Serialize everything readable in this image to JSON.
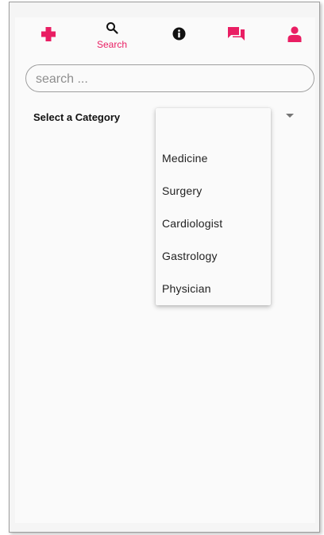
{
  "colors": {
    "accent": "#e91e63",
    "icon_dark": "#111111",
    "border": "#9e9e9e",
    "text": "#222222"
  },
  "nav": {
    "items": [
      {
        "icon": "medical-cross-icon",
        "label": ""
      },
      {
        "icon": "search-icon",
        "label": "Search"
      },
      {
        "icon": "info-icon",
        "label": ""
      },
      {
        "icon": "chat-icon",
        "label": ""
      },
      {
        "icon": "person-icon",
        "label": ""
      }
    ]
  },
  "search": {
    "placeholder": "search ...",
    "value": ""
  },
  "category": {
    "label": "Select a Category",
    "selected": "",
    "options": [
      "Medicine",
      "Surgery",
      "Cardiologist",
      "Gastrology",
      "Physician"
    ]
  }
}
